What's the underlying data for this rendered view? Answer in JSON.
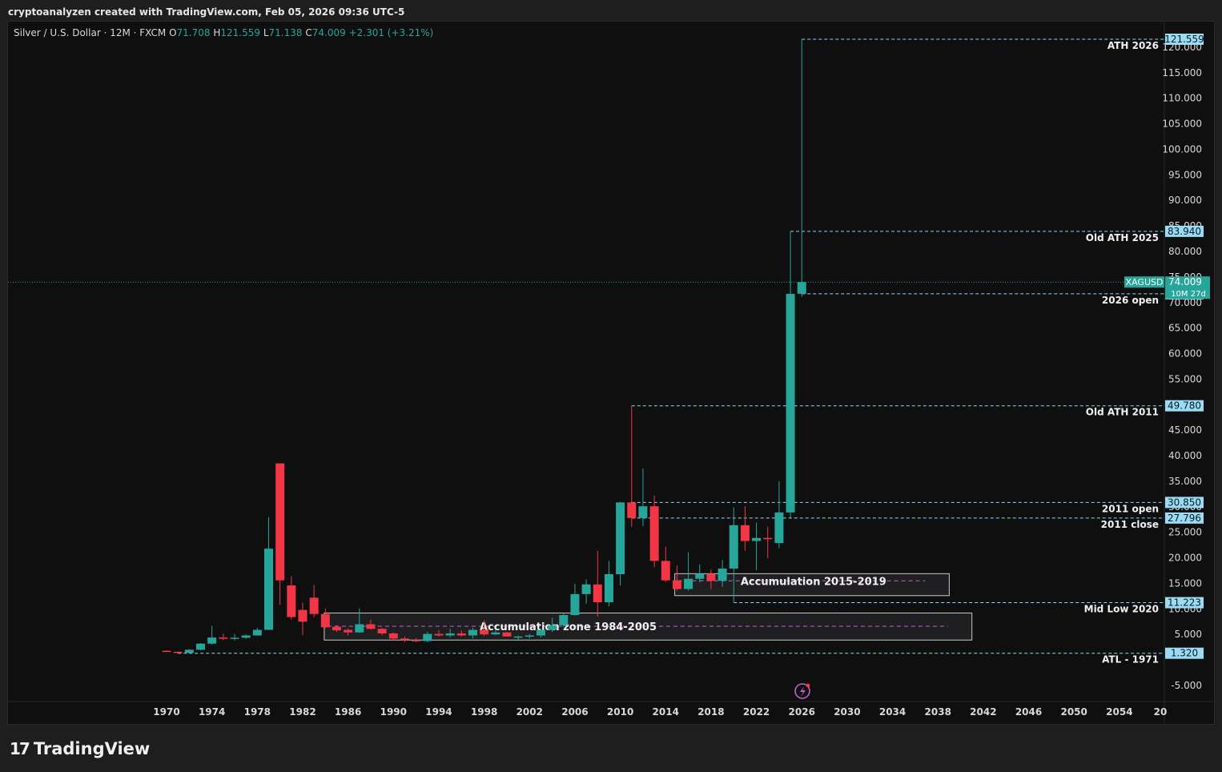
{
  "header": {
    "text": "cryptoanalyzen created with TradingView.com, Feb 05, 2026 09:36 UTC-5"
  },
  "legend": {
    "symbol": "Silver / U.S. Dollar · 12M · FXCM",
    "o_key": "O",
    "o_val": "71.708",
    "h_key": "H",
    "h_val": "121.559",
    "l_key": "L",
    "l_val": "71.138",
    "c_key": "C",
    "c_val": "74.009",
    "change": "+2.301 (+3.21%)"
  },
  "footer": {
    "brand": "TradingView"
  },
  "colors": {
    "up": "#26a69a",
    "down": "#f23645",
    "level": "#8fd8f0",
    "badge": "#9adcf5",
    "zone": "#c060d0",
    "bg": "#0f0f0f",
    "text": "#d8d8d8"
  },
  "chart_data": {
    "type": "candlestick",
    "title": "Silver / U.S. Dollar · 12M · FXCM",
    "y_ticks": [
      "-5.000",
      "5.000",
      "10.000",
      "15.000",
      "20.000",
      "25.000",
      "30.000",
      "35.000",
      "40.000",
      "45.000",
      "50.000",
      "55.000",
      "60.000",
      "65.000",
      "70.000",
      "75.000",
      "80.000",
      "85.000",
      "90.000",
      "95.000",
      "100.000",
      "105.000",
      "110.000",
      "115.000",
      "120.000"
    ],
    "x_ticks": [
      "1970",
      "1974",
      "1978",
      "1982",
      "1986",
      "1990",
      "1994",
      "1998",
      "2002",
      "2006",
      "2010",
      "2014",
      "2018",
      "2022",
      "2026",
      "2030",
      "2034",
      "2038",
      "2042",
      "2046",
      "2050",
      "2054",
      "20"
    ],
    "ylim": [
      -8,
      123
    ],
    "xlim": [
      1969.2,
      2058.0
    ],
    "candles": [
      {
        "x": 1970,
        "o": 1.8,
        "h": 1.9,
        "l": 1.55,
        "c": 1.6
      },
      {
        "x": 1971,
        "o": 1.6,
        "h": 1.7,
        "l": 1.3,
        "c": 1.4
      },
      {
        "x": 1972,
        "o": 1.4,
        "h": 2.1,
        "l": 1.32,
        "c": 2.0
      },
      {
        "x": 1973,
        "o": 2.0,
        "h": 3.3,
        "l": 1.9,
        "c": 3.2
      },
      {
        "x": 1974,
        "o": 3.2,
        "h": 6.7,
        "l": 3.0,
        "c": 4.4
      },
      {
        "x": 1975,
        "o": 4.4,
        "h": 5.2,
        "l": 3.9,
        "c": 4.2
      },
      {
        "x": 1976,
        "o": 4.2,
        "h": 5.1,
        "l": 3.8,
        "c": 4.35
      },
      {
        "x": 1977,
        "o": 4.35,
        "h": 5.0,
        "l": 4.2,
        "c": 4.8
      },
      {
        "x": 1978,
        "o": 4.8,
        "h": 6.3,
        "l": 4.8,
        "c": 5.9
      },
      {
        "x": 1979,
        "o": 5.9,
        "h": 28.0,
        "l": 5.9,
        "c": 21.8
      },
      {
        "x": 1980,
        "o": 38.5,
        "h": 38.5,
        "l": 10.8,
        "c": 15.6
      },
      {
        "x": 1981,
        "o": 14.6,
        "h": 16.4,
        "l": 7.9,
        "c": 8.4
      },
      {
        "x": 1982,
        "o": 9.8,
        "h": 11.2,
        "l": 4.9,
        "c": 7.5
      },
      {
        "x": 1983,
        "o": 12.2,
        "h": 14.7,
        "l": 8.4,
        "c": 9.0
      },
      {
        "x": 1984,
        "o": 9.0,
        "h": 10.1,
        "l": 6.2,
        "c": 6.4
      },
      {
        "x": 1985,
        "o": 6.5,
        "h": 6.8,
        "l": 5.5,
        "c": 5.8
      },
      {
        "x": 1986,
        "o": 5.9,
        "h": 6.2,
        "l": 4.8,
        "c": 5.4
      },
      {
        "x": 1987,
        "o": 5.4,
        "h": 10.1,
        "l": 5.3,
        "c": 7.0
      },
      {
        "x": 1988,
        "o": 7.0,
        "h": 7.9,
        "l": 5.9,
        "c": 6.1
      },
      {
        "x": 1989,
        "o": 6.1,
        "h": 6.3,
        "l": 4.9,
        "c": 5.2
      },
      {
        "x": 1990,
        "o": 5.2,
        "h": 5.4,
        "l": 3.9,
        "c": 4.2
      },
      {
        "x": 1991,
        "o": 4.2,
        "h": 4.6,
        "l": 3.5,
        "c": 3.9
      },
      {
        "x": 1992,
        "o": 3.9,
        "h": 4.3,
        "l": 3.5,
        "c": 3.7
      },
      {
        "x": 1993,
        "o": 3.7,
        "h": 5.5,
        "l": 3.5,
        "c": 5.1
      },
      {
        "x": 1994,
        "o": 5.1,
        "h": 5.8,
        "l": 4.6,
        "c": 4.8
      },
      {
        "x": 1995,
        "o": 4.8,
        "h": 6.1,
        "l": 4.4,
        "c": 5.2
      },
      {
        "x": 1996,
        "o": 5.2,
        "h": 5.8,
        "l": 4.6,
        "c": 4.8
      },
      {
        "x": 1997,
        "o": 4.8,
        "h": 6.3,
        "l": 4.2,
        "c": 5.9
      },
      {
        "x": 1998,
        "o": 5.9,
        "h": 7.8,
        "l": 4.7,
        "c": 5.0
      },
      {
        "x": 1999,
        "o": 5.0,
        "h": 5.8,
        "l": 4.9,
        "c": 5.4
      },
      {
        "x": 2000,
        "o": 5.4,
        "h": 5.5,
        "l": 4.6,
        "c": 4.6
      },
      {
        "x": 2001,
        "o": 4.6,
        "h": 4.8,
        "l": 4.0,
        "c": 4.6
      },
      {
        "x": 2002,
        "o": 4.6,
        "h": 5.1,
        "l": 4.2,
        "c": 4.8
      },
      {
        "x": 2003,
        "o": 4.8,
        "h": 6.0,
        "l": 4.4,
        "c": 5.9
      },
      {
        "x": 2004,
        "o": 5.9,
        "h": 8.3,
        "l": 5.5,
        "c": 6.8
      },
      {
        "x": 2005,
        "o": 6.8,
        "h": 9.2,
        "l": 6.4,
        "c": 8.8
      },
      {
        "x": 2006,
        "o": 8.8,
        "h": 14.9,
        "l": 8.7,
        "c": 12.9
      },
      {
        "x": 2007,
        "o": 12.9,
        "h": 15.8,
        "l": 11.0,
        "c": 14.8
      },
      {
        "x": 2008,
        "o": 14.8,
        "h": 21.4,
        "l": 8.5,
        "c": 11.3
      },
      {
        "x": 2009,
        "o": 11.3,
        "h": 19.4,
        "l": 10.5,
        "c": 16.8
      },
      {
        "x": 2010,
        "o": 16.8,
        "h": 31.0,
        "l": 14.6,
        "c": 30.85
      },
      {
        "x": 2011,
        "o": 30.85,
        "h": 49.78,
        "l": 26.1,
        "c": 27.8
      },
      {
        "x": 2012,
        "o": 27.8,
        "h": 37.5,
        "l": 26.2,
        "c": 30.1
      },
      {
        "x": 2013,
        "o": 30.1,
        "h": 32.2,
        "l": 18.2,
        "c": 19.4
      },
      {
        "x": 2014,
        "o": 19.4,
        "h": 22.2,
        "l": 15.3,
        "c": 15.6
      },
      {
        "x": 2015,
        "o": 15.6,
        "h": 18.5,
        "l": 13.6,
        "c": 13.9
      },
      {
        "x": 2016,
        "o": 13.9,
        "h": 21.1,
        "l": 13.6,
        "c": 15.9
      },
      {
        "x": 2017,
        "o": 15.9,
        "h": 18.7,
        "l": 15.2,
        "c": 16.9
      },
      {
        "x": 2018,
        "o": 16.9,
        "h": 17.7,
        "l": 13.9,
        "c": 15.5
      },
      {
        "x": 2019,
        "o": 15.5,
        "h": 19.6,
        "l": 14.3,
        "c": 17.9
      },
      {
        "x": 2020,
        "o": 17.9,
        "h": 29.9,
        "l": 11.22,
        "c": 26.4
      },
      {
        "x": 2021,
        "o": 26.4,
        "h": 30.1,
        "l": 21.4,
        "c": 23.3
      },
      {
        "x": 2022,
        "o": 23.3,
        "h": 26.9,
        "l": 17.6,
        "c": 23.9
      },
      {
        "x": 2023,
        "o": 23.9,
        "h": 26.1,
        "l": 19.9,
        "c": 23.8
      },
      {
        "x": 2024,
        "o": 22.9,
        "h": 35.0,
        "l": 21.9,
        "c": 28.9
      },
      {
        "x": 2025,
        "o": 28.9,
        "h": 83.94,
        "l": 27.8,
        "c": 71.7
      },
      {
        "x": 2026,
        "o": 71.708,
        "h": 121.559,
        "l": 71.138,
        "c": 74.009
      }
    ],
    "levels": [
      {
        "value": 121.559,
        "label": "ATH 2026",
        "badge": "121.559",
        "x0": 2026
      },
      {
        "value": 83.94,
        "label": "Old ATH 2025",
        "badge": "83.940",
        "x0": 2025
      },
      {
        "value": 71.708,
        "label": "2026 open",
        "badge": "71.708",
        "x0": 2026
      },
      {
        "value": 49.78,
        "label": "Old ATH 2011",
        "badge": "49.780",
        "x0": 2011
      },
      {
        "value": 30.85,
        "label": "2011 open",
        "badge": "30.850",
        "x0": 2011
      },
      {
        "value": 27.796,
        "label": "2011 close",
        "badge": "27.796",
        "x0": 2011
      },
      {
        "value": 11.223,
        "label": "Mid Low 2020",
        "badge": "11.223",
        "x0": 2020
      },
      {
        "value": 1.32,
        "label": "ATL - 1971",
        "badge": "1.320",
        "x0": 1971
      }
    ],
    "last_price": {
      "value": 74.009,
      "symbol": "XAGUSD",
      "price": "74.009",
      "countdown": "10M 27d"
    },
    "zones": [
      {
        "label": "Accumulation zone 1984-2005",
        "x0": 1983.9,
        "x1": 2041.0,
        "y0": 3.9,
        "y1": 9.2,
        "mid": 6.6
      },
      {
        "label": "Accumulation 2015-2019",
        "x0": 2014.8,
        "x1": 2039.0,
        "y0": 12.6,
        "y1": 16.9,
        "mid": 15.5
      }
    ]
  }
}
